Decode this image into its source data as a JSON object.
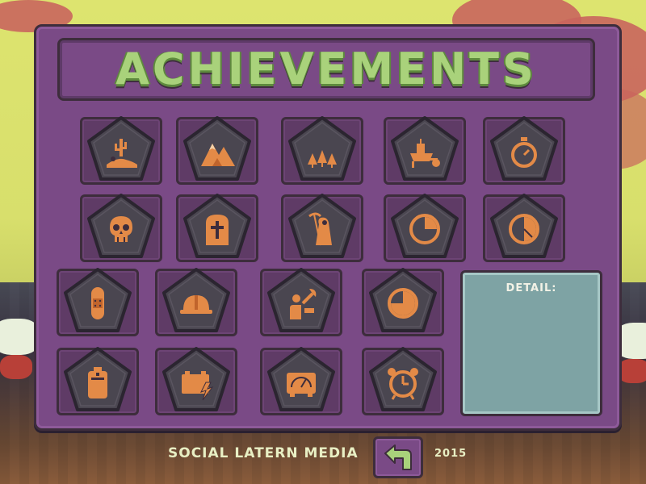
{
  "header": {
    "title": "ACHIEVEMENTS"
  },
  "detail": {
    "label": "DETAIL:"
  },
  "footer": {
    "credit": "SOCIAL LATERN MEDIA",
    "year": "2015"
  },
  "achievements": [
    {
      "icon": "desert-cactus-icon"
    },
    {
      "icon": "mountains-icon"
    },
    {
      "icon": "forest-trees-icon"
    },
    {
      "icon": "wheelbarrow-icon"
    },
    {
      "icon": "stopwatch-icon"
    },
    {
      "icon": "skull-icon"
    },
    {
      "icon": "tombstone-icon"
    },
    {
      "icon": "grim-reaper-icon"
    },
    {
      "icon": "clock-quarter-icon"
    },
    {
      "icon": "clock-half-icon"
    },
    {
      "icon": "bandage-icon"
    },
    {
      "icon": "hard-hat-icon"
    },
    {
      "icon": "mechanic-wrench-icon"
    },
    {
      "icon": "clock-three-quarter-icon"
    },
    {
      "icon": "battery-icon"
    },
    {
      "icon": "car-battery-icon"
    },
    {
      "icon": "gauge-meter-icon"
    },
    {
      "icon": "alarm-clock-icon"
    }
  ],
  "colors": {
    "panel": "#7a4a86",
    "title": "#a9d27b",
    "icon": "#e38a47",
    "pentagon": "#4a4650",
    "detail": "#7ea3a4"
  }
}
